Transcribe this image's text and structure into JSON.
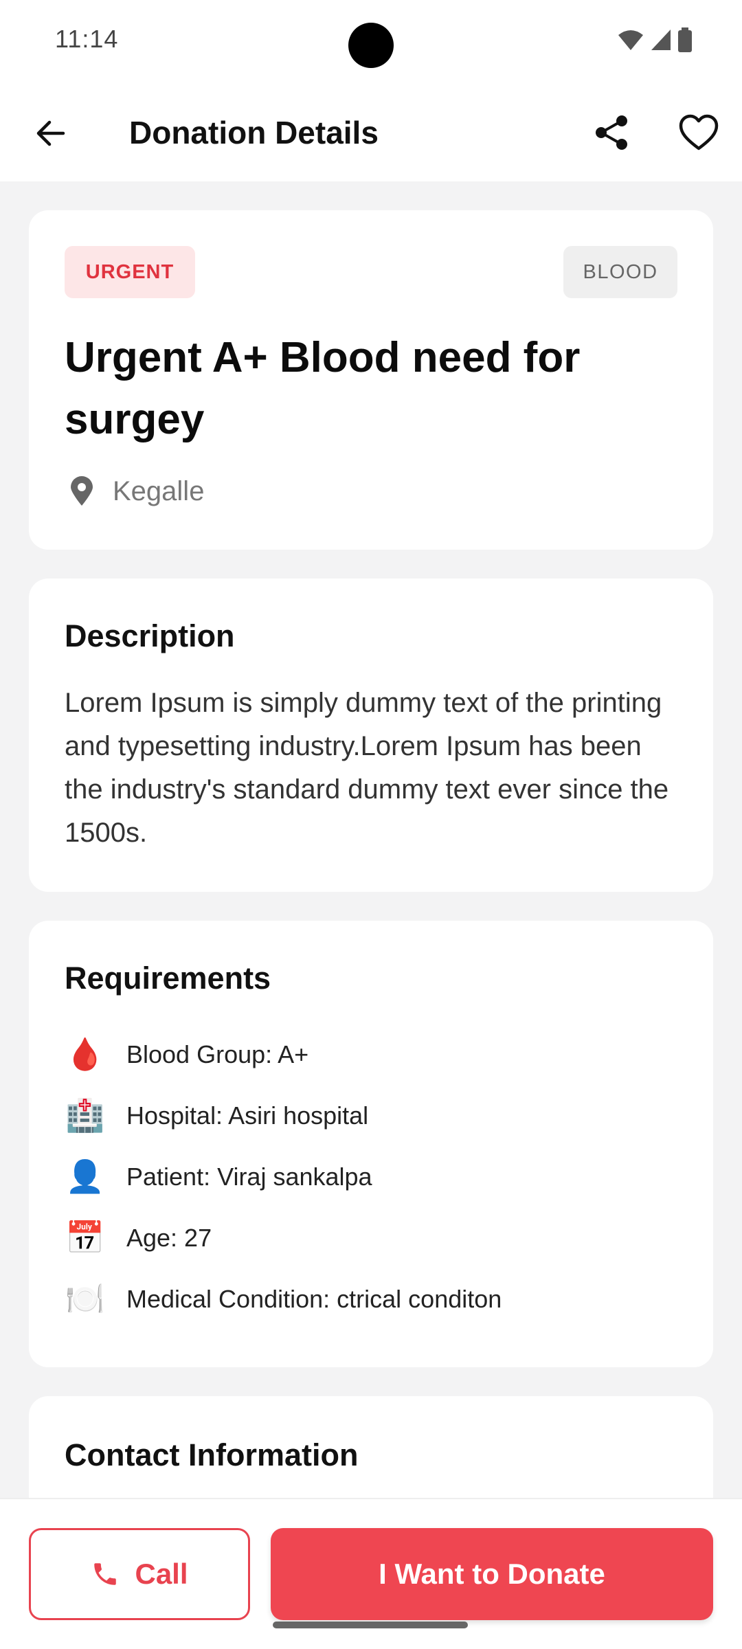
{
  "status_bar": {
    "time": "11:14"
  },
  "app_bar": {
    "title": "Donation Details"
  },
  "request": {
    "urgency_badge": "URGENT",
    "type_badge": "BLOOD",
    "title": "Urgent A+ Blood need for surgey",
    "location": "Kegalle"
  },
  "description": {
    "heading": "Description",
    "text": "Lorem Ipsum is simply dummy text of the printing and typesetting industry.Lorem Ipsum has been the industry's standard dummy text ever since the 1500s."
  },
  "requirements": {
    "heading": "Requirements",
    "items": [
      {
        "icon": "blood-drop-icon",
        "glyph": "🩸",
        "label": "Blood Group: A+"
      },
      {
        "icon": "hospital-icon",
        "glyph": "🏥",
        "label": "Hospital: Asiri hospital"
      },
      {
        "icon": "person-icon",
        "glyph": "👤",
        "label": "Patient: Viraj sankalpa"
      },
      {
        "icon": "calendar-icon",
        "glyph": "📅",
        "label": "Age: 27"
      },
      {
        "icon": "plate-icon",
        "glyph": "🍽️",
        "label": "Medical Condition: ctrical conditon"
      }
    ]
  },
  "contact": {
    "heading": "Contact Information"
  },
  "actions": {
    "call_label": "Call",
    "donate_label": "I Want to Donate"
  },
  "colors": {
    "accent": "#ef4651",
    "urgent_bg": "#fde6e7",
    "urgent_text": "#e0333f"
  }
}
